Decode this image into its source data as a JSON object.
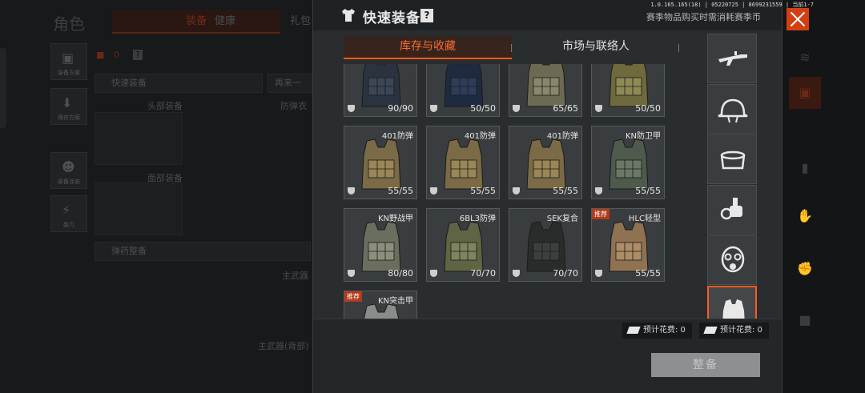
{
  "system_info": "1.0.165.165(18) | 05220725 | 86992315​59 | 当前1-7",
  "background": {
    "title": "角色",
    "tabs": [
      "装备",
      "健康",
      "礼包"
    ],
    "side_buttons": [
      "装备方案",
      "保存方案",
      "装备涂装",
      "能力"
    ],
    "cash": "0",
    "quick_equip": "快速装备",
    "again": "再来一",
    "slot_labels": [
      "头部装备",
      "防弹衣",
      "面部装备",
      "主武器",
      "主武器(背部)"
    ],
    "ammo_equip": "弹药整备"
  },
  "modal": {
    "title": "快速装备",
    "help_label": "?",
    "notice": "赛季物品购买时需消耗赛季币",
    "tabs": [
      {
        "label": "库存与收藏",
        "active": true
      },
      {
        "label": "市场与联络人",
        "active": false
      }
    ],
    "items": [
      {
        "name": "",
        "durability": "90/90",
        "recommended": false,
        "style": "dark-blue"
      },
      {
        "name": "",
        "durability": "50/50",
        "recommended": false,
        "style": "navy"
      },
      {
        "name": "",
        "durability": "65/65",
        "recommended": false,
        "style": "camo"
      },
      {
        "name": "",
        "durability": "50/50",
        "recommended": false,
        "style": "olive"
      },
      {
        "name": "401防弹",
        "durability": "55/55",
        "recommended": false,
        "style": "multicam"
      },
      {
        "name": "401防弹",
        "durability": "55/55",
        "recommended": false,
        "style": "multicam"
      },
      {
        "name": "401防弹",
        "durability": "55/55",
        "recommended": false,
        "style": "multicam"
      },
      {
        "name": "KN防卫甲",
        "durability": "55/55",
        "recommended": false,
        "style": "green-grey"
      },
      {
        "name": "KN野战甲",
        "durability": "80/80",
        "recommended": false,
        "style": "grey-camo"
      },
      {
        "name": "6BL3防弹",
        "durability": "70/70",
        "recommended": false,
        "style": "olive-camo"
      },
      {
        "name": "SEK复合",
        "durability": "70/70",
        "recommended": false,
        "style": "black"
      },
      {
        "name": "HLC轻型",
        "durability": "55/55",
        "recommended": true,
        "style": "tan"
      },
      {
        "name": "KN突击甲",
        "durability": "",
        "recommended": true,
        "style": "light-grey"
      }
    ],
    "recommend_label": "推荐",
    "categories": [
      {
        "icon": "rifle-icon",
        "active": false
      },
      {
        "icon": "helmet-icon",
        "active": false
      },
      {
        "icon": "pot-icon",
        "active": false
      },
      {
        "icon": "night-vision-icon",
        "active": false
      },
      {
        "icon": "gas-mask-icon",
        "active": false
      },
      {
        "icon": "vest-icon",
        "active": true
      }
    ],
    "costs": [
      {
        "label": "预计花费: 0"
      },
      {
        "label": "预计花费: 0"
      }
    ],
    "equip_button": "整备"
  },
  "colors": {
    "accent": "#ff5a1f",
    "close": "#d33f12",
    "panel": "#2a2d30"
  }
}
